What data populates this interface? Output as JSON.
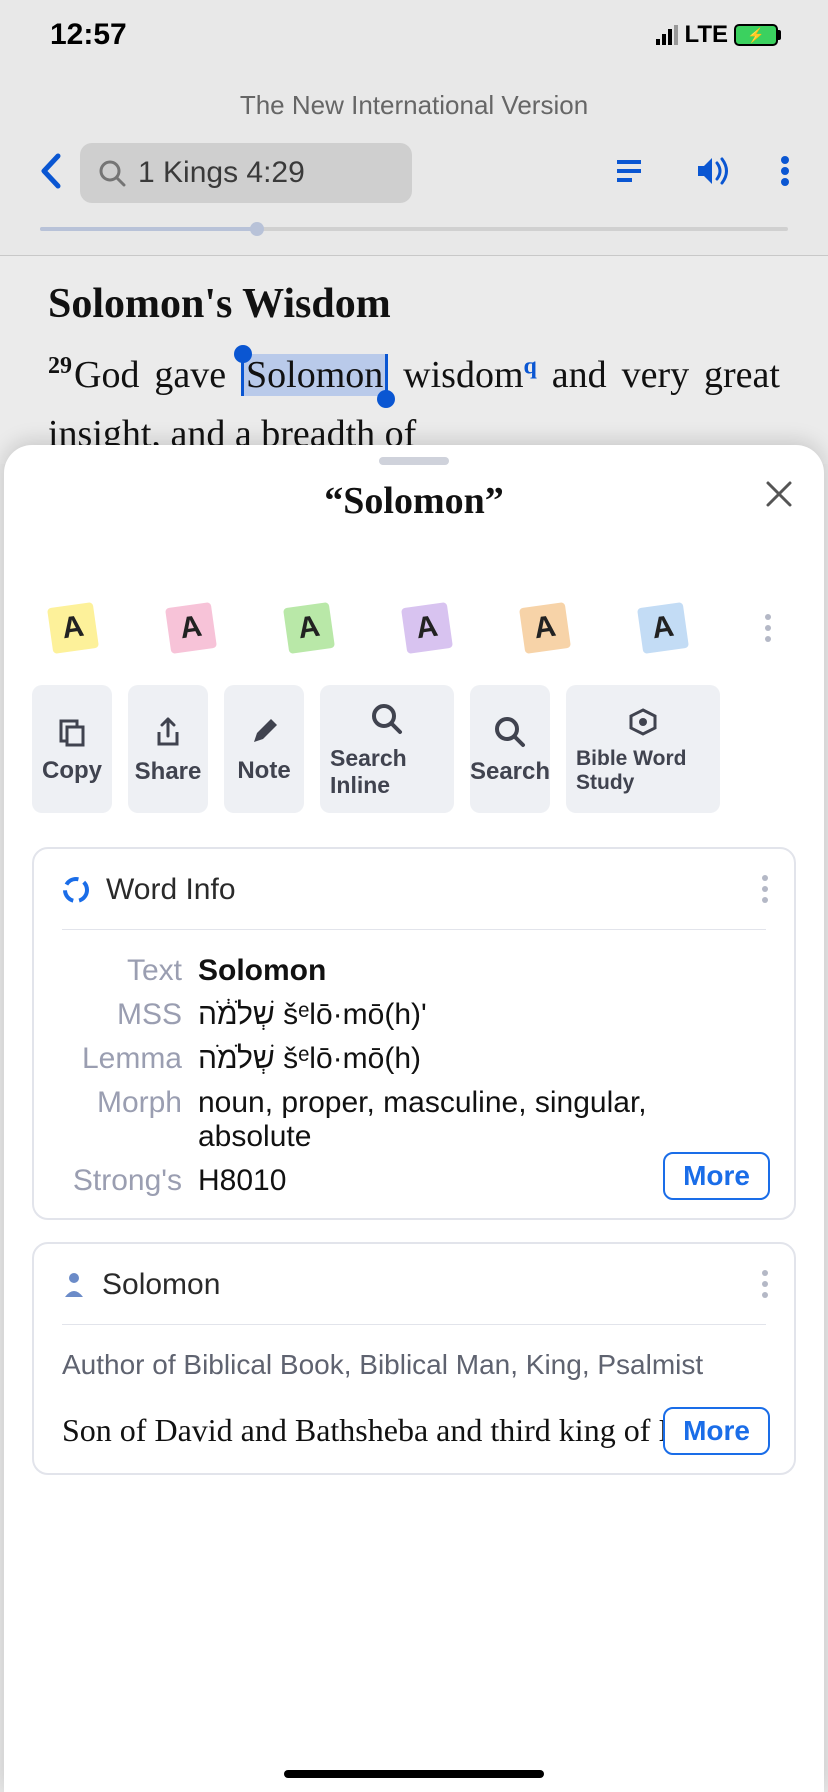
{
  "status": {
    "time": "12:57",
    "network": "LTE"
  },
  "header": {
    "version": "The New International Version",
    "reference": "1 Kings 4:29"
  },
  "passage": {
    "title": "Solomon's Wisdom",
    "verse_num": "29",
    "p1": "God gave ",
    "selected": "Solomon",
    "p2": " wisdom",
    "fn": "q",
    "p3": " and very great insight, and a breadth of"
  },
  "sheet": {
    "title": "“Solomon”",
    "highlight_letter": "A",
    "actions": {
      "copy": "Copy",
      "share": "Share",
      "note": "Note",
      "search_inline": "Search Inline",
      "search": "Search",
      "bws": "Bible Word Study"
    }
  },
  "wordinfo": {
    "card_title": "Word Info",
    "labels": {
      "text": "Text",
      "mss": "MSS",
      "lemma": "Lemma",
      "morph": "Morph",
      "strongs": "Strong's"
    },
    "text": "Solomon",
    "mss": "שְׁלֹמֹ֔ה šᵉlō·mō(h)ʹ",
    "lemma": "שְׁלֹמֹה šᵉlō·mō(h)",
    "morph": "noun, proper, masculine, singular, absolute",
    "strongs": "H8010",
    "more": "More"
  },
  "bio": {
    "name": "Solomon",
    "roles": "Author of Biblical Book, Biblical Man, King, Psalmist",
    "desc": "Son of David and Bathsheba and third king of Israel.",
    "more": "More"
  }
}
